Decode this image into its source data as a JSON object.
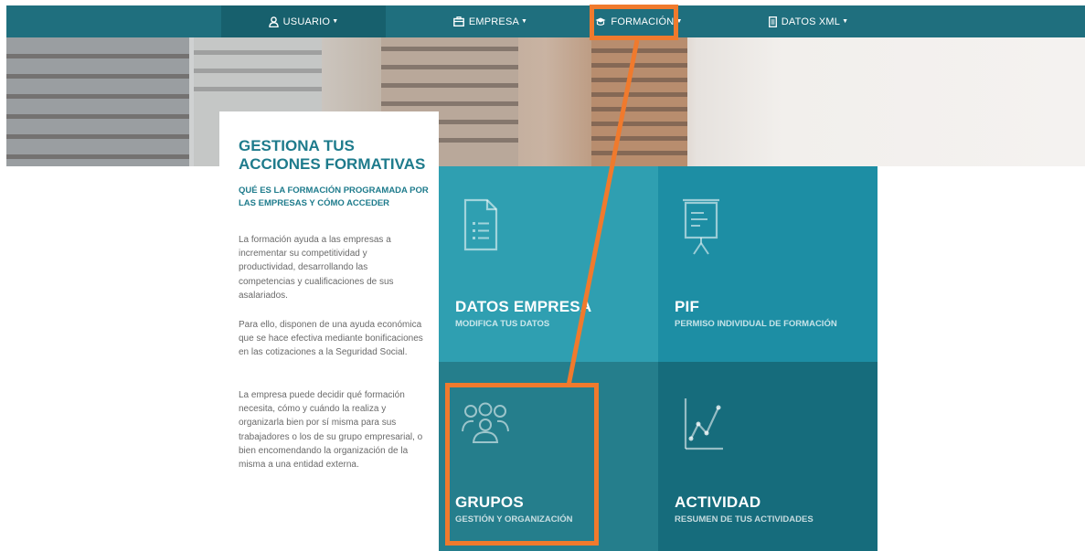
{
  "nav": {
    "items": [
      {
        "label": "USUARIO",
        "icon": "user-icon"
      },
      {
        "label": "EMPRESA",
        "icon": "briefcase-icon"
      },
      {
        "label": "FORMACIÓN",
        "icon": "graduation-cap-icon"
      },
      {
        "label": "DATOS XML",
        "icon": "document-icon"
      }
    ]
  },
  "card": {
    "title": "GESTIONA TUS ACCIONES FORMATIVAS",
    "subtitle": "QUÉ ES LA FORMACIÓN PROGRAMADA POR LAS EMPRESAS Y CÓMO ACCEDER",
    "paragraphs": [
      "La formación ayuda a las empresas a incrementar su competitividad y productividad, desarrollando las competencias y cualificaciones de sus asalariados.",
      "Para ello, disponen de una ayuda económica que se hace efectiva mediante bonificaciones en las cotizaciones a la Seguridad Social.",
      "La empresa puede decidir qué formación necesita, cómo y cuándo la realiza y organizarla bien por sí misma para sus trabajadores o los de su grupo empresarial, o bien encomendando la organización de la misma a una entidad externa."
    ]
  },
  "tiles": [
    {
      "title": "DATOS EMPRESA",
      "subtitle": "MODIFICA TUS DATOS",
      "icon": "document-list-icon"
    },
    {
      "title": "PIF",
      "subtitle": "PERMISO INDIVIDUAL DE FORMACIÓN",
      "icon": "presentation-board-icon"
    },
    {
      "title": "GRUPOS",
      "subtitle": "GESTIÓN Y ORGANIZACIÓN",
      "icon": "group-users-icon"
    },
    {
      "title": "ACTIVIDAD",
      "subtitle": "RESUMEN DE TUS ACTIVIDADES",
      "icon": "line-chart-icon"
    }
  ],
  "colors": {
    "nav_bg": "#1f6f7e",
    "accent": "#1e7b8c",
    "highlight": "#f07a2d",
    "tile_datos": "#2f9fb1",
    "tile_pif": "#1d8ea4",
    "tile_grupos": "#257e8c",
    "tile_actividad": "#166c7c"
  }
}
